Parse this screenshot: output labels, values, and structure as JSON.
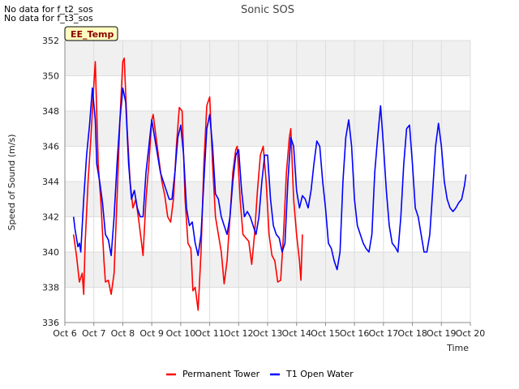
{
  "notes": [
    "No data for f_t2_sos",
    "No data for f_t3_sos"
  ],
  "badge": "EE_Temp",
  "colors": {
    "series1": "#ff0000",
    "series2": "#0000ff",
    "band": "#f0f0f0",
    "grid": "#dddddd",
    "badge_bg": "#ffffc0"
  },
  "chart_data": {
    "type": "line",
    "title": "Sonic SOS",
    "xlabel": "Time",
    "ylabel": "Speed of Sound (m/s)",
    "x_ticks": [
      "Oct 6",
      "Oct 7",
      "Oct 8",
      "Oct 9",
      "Oct 10",
      "Oct 11",
      "Oct 12",
      "Oct 13",
      "Oct 14",
      "Oct 15",
      "Oct 16",
      "Oct 17",
      "Oct 18",
      "Oct 19",
      "Oct 20"
    ],
    "xlim": [
      6,
      20
    ],
    "ylim": [
      336,
      352
    ],
    "y_ticks": [
      336,
      338,
      340,
      342,
      344,
      346,
      348,
      350,
      352
    ],
    "grid": true,
    "legend": "bottom-center",
    "series": [
      {
        "name": "Permanent Tower",
        "points": [
          [
            6.3,
            341.0
          ],
          [
            6.4,
            339.8
          ],
          [
            6.5,
            338.3
          ],
          [
            6.6,
            338.8
          ],
          [
            6.65,
            337.6
          ],
          [
            6.7,
            340.5
          ],
          [
            6.8,
            344.0
          ],
          [
            6.9,
            346.5
          ],
          [
            7.0,
            349.5
          ],
          [
            7.05,
            350.8
          ],
          [
            7.15,
            345.0
          ],
          [
            7.25,
            342.7
          ],
          [
            7.35,
            339.5
          ],
          [
            7.4,
            338.3
          ],
          [
            7.5,
            338.4
          ],
          [
            7.6,
            337.6
          ],
          [
            7.7,
            338.8
          ],
          [
            7.8,
            343.0
          ],
          [
            7.9,
            347.5
          ],
          [
            8.0,
            350.8
          ],
          [
            8.05,
            351.0
          ],
          [
            8.15,
            347.0
          ],
          [
            8.25,
            344.0
          ],
          [
            8.35,
            342.5
          ],
          [
            8.45,
            343.0
          ],
          [
            8.55,
            341.8
          ],
          [
            8.65,
            340.5
          ],
          [
            8.7,
            339.8
          ],
          [
            8.8,
            343.0
          ],
          [
            8.9,
            345.0
          ],
          [
            9.0,
            347.5
          ],
          [
            9.05,
            347.8
          ],
          [
            9.15,
            346.5
          ],
          [
            9.25,
            345.2
          ],
          [
            9.35,
            344.0
          ],
          [
            9.45,
            343.2
          ],
          [
            9.55,
            342.0
          ],
          [
            9.65,
            341.7
          ],
          [
            9.75,
            343.0
          ],
          [
            9.85,
            346.0
          ],
          [
            9.95,
            348.2
          ],
          [
            10.05,
            348.0
          ],
          [
            10.15,
            343.0
          ],
          [
            10.25,
            340.5
          ],
          [
            10.35,
            340.2
          ],
          [
            10.42,
            337.8
          ],
          [
            10.5,
            338.0
          ],
          [
            10.6,
            336.7
          ],
          [
            10.7,
            340.0
          ],
          [
            10.8,
            345.0
          ],
          [
            10.9,
            348.3
          ],
          [
            11.0,
            348.8
          ],
          [
            11.1,
            345.0
          ],
          [
            11.2,
            342.0
          ],
          [
            11.3,
            341.0
          ],
          [
            11.4,
            340.0
          ],
          [
            11.5,
            338.2
          ],
          [
            11.6,
            339.5
          ],
          [
            11.7,
            342.0
          ],
          [
            11.8,
            344.5
          ],
          [
            11.9,
            345.8
          ],
          [
            11.95,
            346.0
          ],
          [
            12.05,
            343.0
          ],
          [
            12.15,
            341.0
          ],
          [
            12.25,
            340.8
          ],
          [
            12.35,
            340.6
          ],
          [
            12.45,
            339.3
          ],
          [
            12.55,
            341.0
          ],
          [
            12.65,
            343.5
          ],
          [
            12.75,
            345.5
          ],
          [
            12.85,
            346.0
          ],
          [
            12.95,
            344.0
          ],
          [
            13.05,
            341.0
          ],
          [
            13.15,
            339.8
          ],
          [
            13.25,
            339.5
          ],
          [
            13.35,
            338.3
          ],
          [
            13.45,
            338.4
          ],
          [
            13.55,
            341.0
          ],
          [
            13.65,
            344.5
          ],
          [
            13.75,
            346.5
          ],
          [
            13.8,
            347.0
          ],
          [
            13.9,
            343.0
          ],
          [
            14.0,
            341.0
          ],
          [
            14.1,
            339.5
          ],
          [
            14.15,
            338.4
          ],
          [
            14.2,
            341.0
          ]
        ]
      },
      {
        "name": "T1 Open Water",
        "points": [
          [
            6.3,
            342.0
          ],
          [
            6.35,
            341.3
          ],
          [
            6.45,
            340.3
          ],
          [
            6.5,
            340.5
          ],
          [
            6.55,
            340.0
          ],
          [
            6.65,
            343.0
          ],
          [
            6.75,
            345.5
          ],
          [
            6.85,
            347.2
          ],
          [
            6.95,
            349.3
          ],
          [
            7.05,
            347.5
          ],
          [
            7.1,
            345.0
          ],
          [
            7.2,
            344.0
          ],
          [
            7.3,
            342.8
          ],
          [
            7.4,
            341.0
          ],
          [
            7.5,
            340.7
          ],
          [
            7.6,
            339.8
          ],
          [
            7.7,
            342.0
          ],
          [
            7.8,
            345.0
          ],
          [
            7.9,
            347.5
          ],
          [
            8.0,
            349.3
          ],
          [
            8.1,
            348.5
          ],
          [
            8.2,
            345.0
          ],
          [
            8.3,
            343.0
          ],
          [
            8.4,
            343.5
          ],
          [
            8.5,
            342.5
          ],
          [
            8.6,
            342.0
          ],
          [
            8.7,
            342.0
          ],
          [
            8.8,
            344.5
          ],
          [
            8.9,
            346.0
          ],
          [
            9.0,
            347.5
          ],
          [
            9.1,
            346.5
          ],
          [
            9.2,
            345.5
          ],
          [
            9.3,
            344.5
          ],
          [
            9.4,
            344.0
          ],
          [
            9.5,
            343.5
          ],
          [
            9.6,
            343.0
          ],
          [
            9.7,
            343.0
          ],
          [
            9.8,
            344.5
          ],
          [
            9.9,
            346.5
          ],
          [
            10.0,
            347.2
          ],
          [
            10.1,
            345.5
          ],
          [
            10.2,
            342.5
          ],
          [
            10.3,
            341.5
          ],
          [
            10.4,
            341.7
          ],
          [
            10.5,
            340.5
          ],
          [
            10.6,
            339.8
          ],
          [
            10.7,
            341.0
          ],
          [
            10.8,
            344.0
          ],
          [
            10.9,
            347.0
          ],
          [
            11.0,
            347.8
          ],
          [
            11.1,
            346.0
          ],
          [
            11.2,
            343.3
          ],
          [
            11.3,
            343.0
          ],
          [
            11.4,
            342.0
          ],
          [
            11.5,
            341.5
          ],
          [
            11.6,
            341.0
          ],
          [
            11.7,
            342.0
          ],
          [
            11.8,
            344.0
          ],
          [
            11.9,
            345.5
          ],
          [
            12.0,
            345.8
          ],
          [
            12.1,
            343.5
          ],
          [
            12.2,
            342.0
          ],
          [
            12.3,
            342.3
          ],
          [
            12.4,
            342.0
          ],
          [
            12.5,
            341.5
          ],
          [
            12.6,
            341.0
          ],
          [
            12.7,
            342.0
          ],
          [
            12.8,
            344.0
          ],
          [
            12.9,
            345.5
          ],
          [
            13.0,
            345.5
          ],
          [
            13.1,
            343.0
          ],
          [
            13.2,
            341.5
          ],
          [
            13.3,
            341.0
          ],
          [
            13.4,
            340.8
          ],
          [
            13.5,
            340.0
          ],
          [
            13.6,
            340.5
          ],
          [
            13.7,
            344.0
          ],
          [
            13.8,
            346.5
          ],
          [
            13.9,
            346.0
          ],
          [
            14.0,
            343.5
          ],
          [
            14.1,
            342.5
          ],
          [
            14.2,
            343.2
          ],
          [
            14.3,
            343.0
          ],
          [
            14.4,
            342.5
          ],
          [
            14.5,
            343.5
          ],
          [
            14.6,
            345.0
          ],
          [
            14.7,
            346.3
          ],
          [
            14.8,
            346.0
          ],
          [
            14.9,
            344.0
          ],
          [
            15.0,
            342.5
          ],
          [
            15.1,
            340.5
          ],
          [
            15.2,
            340.2
          ],
          [
            15.3,
            339.5
          ],
          [
            15.4,
            339.0
          ],
          [
            15.5,
            340.0
          ],
          [
            15.6,
            344.0
          ],
          [
            15.7,
            346.5
          ],
          [
            15.8,
            347.5
          ],
          [
            15.9,
            346.0
          ],
          [
            16.0,
            343.0
          ],
          [
            16.1,
            341.5
          ],
          [
            16.2,
            341.0
          ],
          [
            16.3,
            340.5
          ],
          [
            16.4,
            340.2
          ],
          [
            16.5,
            340.0
          ],
          [
            16.6,
            341.0
          ],
          [
            16.7,
            344.5
          ],
          [
            16.8,
            346.5
          ],
          [
            16.9,
            348.3
          ],
          [
            17.0,
            346.0
          ],
          [
            17.1,
            343.5
          ],
          [
            17.2,
            341.5
          ],
          [
            17.3,
            340.5
          ],
          [
            17.4,
            340.3
          ],
          [
            17.5,
            340.0
          ],
          [
            17.6,
            342.0
          ],
          [
            17.7,
            345.0
          ],
          [
            17.8,
            347.0
          ],
          [
            17.9,
            347.2
          ],
          [
            18.0,
            345.0
          ],
          [
            18.1,
            342.5
          ],
          [
            18.2,
            342.0
          ],
          [
            18.3,
            341.0
          ],
          [
            18.4,
            340.0
          ],
          [
            18.5,
            340.0
          ],
          [
            18.6,
            341.0
          ],
          [
            18.7,
            343.5
          ],
          [
            18.8,
            346.0
          ],
          [
            18.9,
            347.3
          ],
          [
            19.0,
            346.0
          ],
          [
            19.1,
            344.0
          ],
          [
            19.2,
            343.0
          ],
          [
            19.3,
            342.5
          ],
          [
            19.4,
            342.3
          ],
          [
            19.5,
            342.5
          ],
          [
            19.6,
            342.8
          ],
          [
            19.7,
            343.0
          ],
          [
            19.8,
            343.8
          ],
          [
            19.85,
            344.4
          ]
        ]
      }
    ]
  }
}
